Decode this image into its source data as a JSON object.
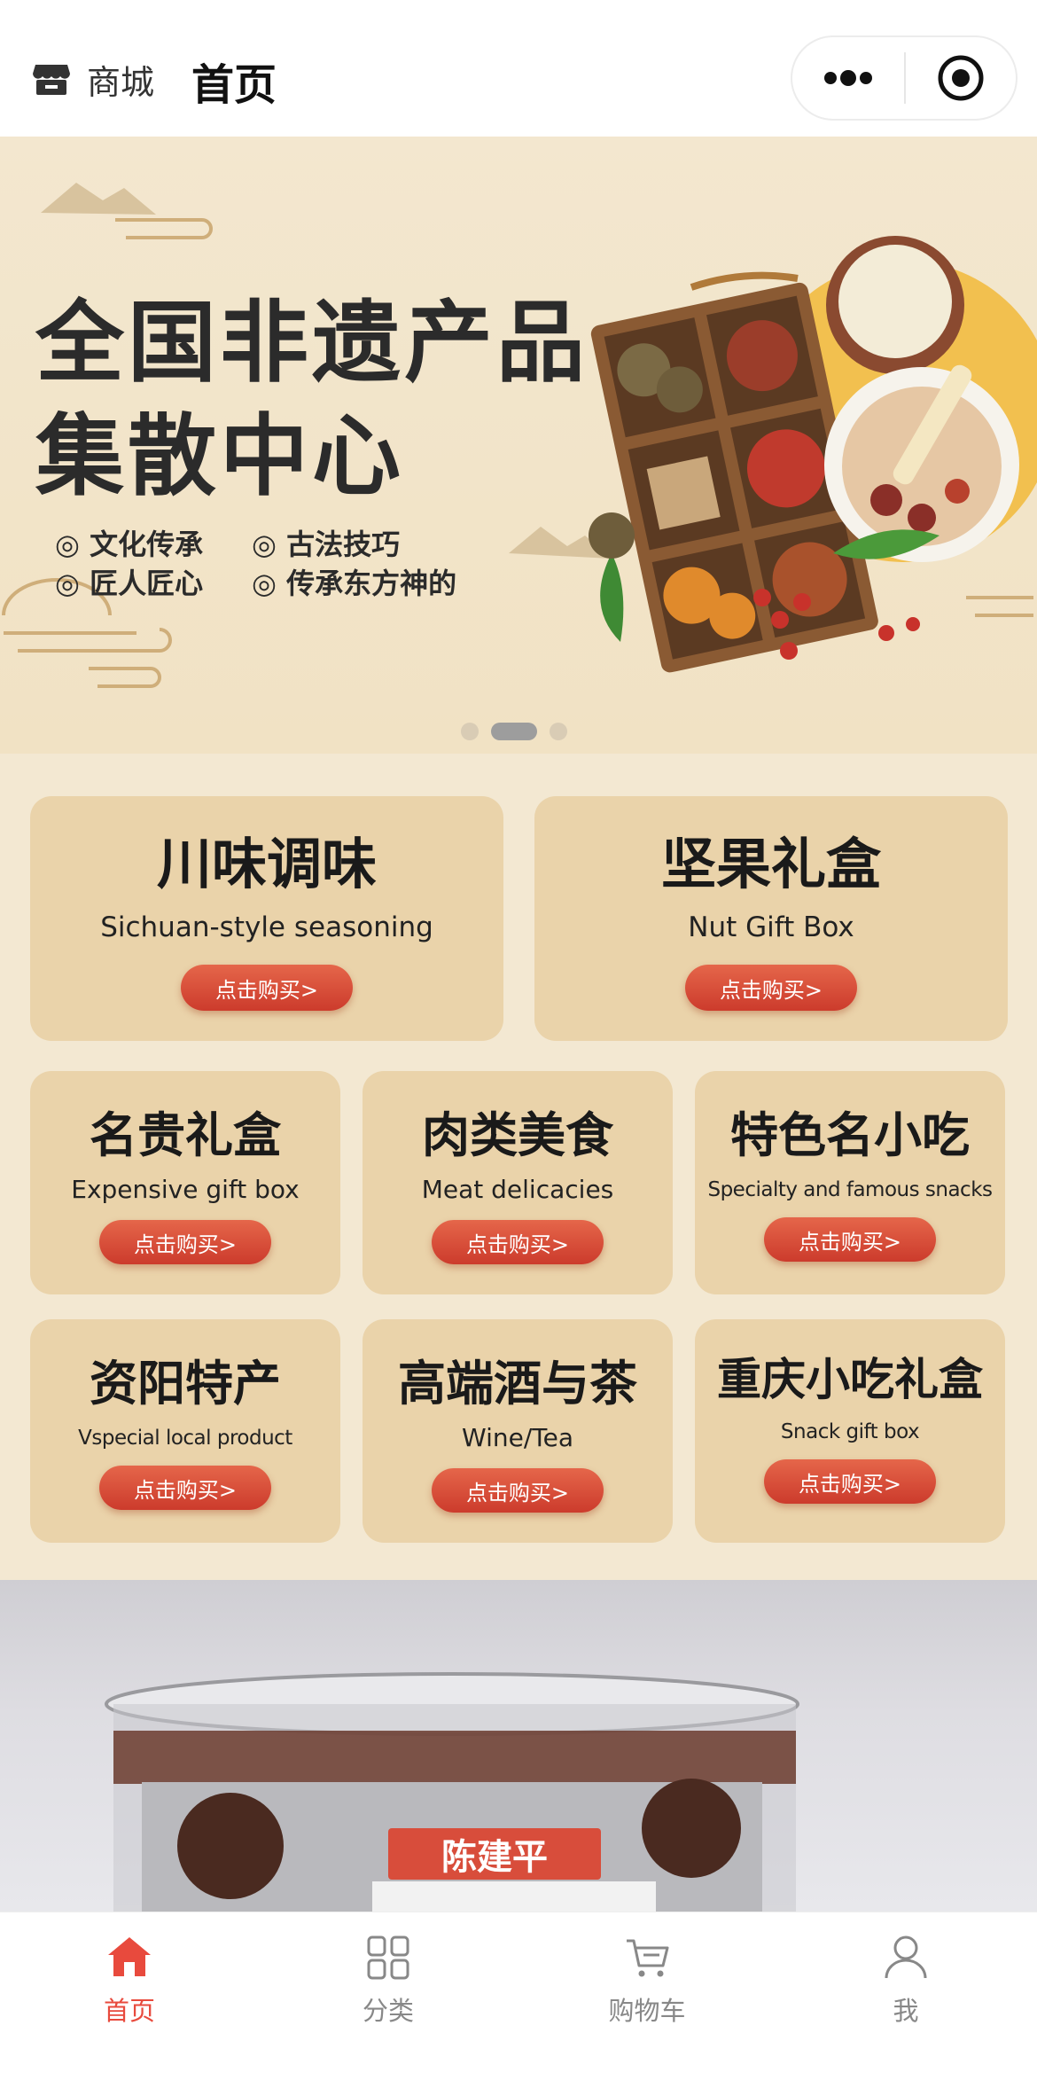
{
  "header": {
    "brand_label": "商城",
    "page_title": "首页"
  },
  "banner": {
    "headline_line1": "全国非遗产品",
    "headline_line2": "集散中心",
    "features": [
      "◎ 文化传承",
      "◎ 古法技巧",
      "◎ 匠人匠心",
      "◎ 传承东方神的"
    ],
    "slide_count": 3,
    "active_slide": 1
  },
  "categories": [
    {
      "cn": "川味调味",
      "en": "Sichuan-style seasoning",
      "button": "点击购买>"
    },
    {
      "cn": "坚果礼盒",
      "en": "Nut Gift Box",
      "button": "点击购买>"
    },
    {
      "cn": "名贵礼盒",
      "en": "Expensive gift box",
      "button": "点击购买>"
    },
    {
      "cn": "肉类美食",
      "en": "Meat delicacies",
      "button": "点击购买>"
    },
    {
      "cn": "特色名小吃",
      "en": "Specialty and famous snacks",
      "button": "点击购买>"
    },
    {
      "cn": "资阳特产",
      "en": "Vspecial local product",
      "button": "点击购买>"
    },
    {
      "cn": "高端酒与茶",
      "en": "Wine/Tea",
      "button": "点击购买>"
    },
    {
      "cn": "重庆小吃礼盒",
      "en": "Snack gift box",
      "button": "点击购买>"
    }
  ],
  "product": {
    "brand_tag": "陈建平"
  },
  "tabbar": {
    "items": [
      {
        "label": "首页",
        "icon": "home-icon",
        "active": true
      },
      {
        "label": "分类",
        "icon": "category-grid-icon",
        "active": false
      },
      {
        "label": "购物车",
        "icon": "cart-icon",
        "active": false
      },
      {
        "label": "我",
        "icon": "user-icon",
        "active": false
      }
    ]
  },
  "colors": {
    "accent": "#e84a3d",
    "card_bg": "#ead3aa",
    "page_bg": "#f3e8d2",
    "button": "#d9483a"
  }
}
